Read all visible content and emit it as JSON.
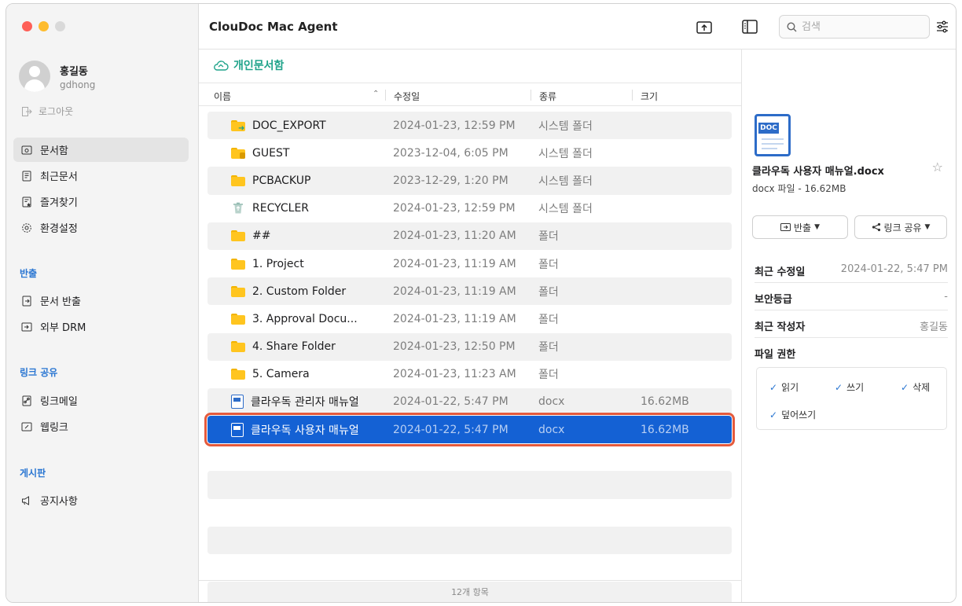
{
  "app": {
    "title": "ClouDoc Mac Agent"
  },
  "search": {
    "placeholder": "검색"
  },
  "user": {
    "name": "홍길동",
    "id": "gdhong",
    "logout_label": "로그아웃"
  },
  "sidebar": {
    "main_items": [
      {
        "label": "문서함",
        "icon": "inbox-icon",
        "active": true
      },
      {
        "label": "최근문서",
        "icon": "recent-doc-icon"
      },
      {
        "label": "즐겨찾기",
        "icon": "favorite-doc-icon"
      },
      {
        "label": "환경설정",
        "icon": "gear-icon"
      }
    ],
    "export_section": {
      "title": "반출",
      "items": [
        {
          "label": "문서 반출",
          "icon": "doc-export-icon"
        },
        {
          "label": "외부 DRM",
          "icon": "external-drm-icon"
        }
      ]
    },
    "link_section": {
      "title": "링크 공유",
      "items": [
        {
          "label": "링크메일",
          "icon": "link-mail-icon"
        },
        {
          "label": "웹링크",
          "icon": "web-link-icon"
        }
      ]
    },
    "board_section": {
      "title": "게시판",
      "items": [
        {
          "label": "공지사항",
          "icon": "megaphone-icon"
        }
      ]
    }
  },
  "location": {
    "label": "개인문서함",
    "icon": "cloud-icon"
  },
  "columns": {
    "name": "이름",
    "date": "수정일",
    "type": "종류",
    "size": "크기"
  },
  "files": [
    {
      "name": "DOC_EXPORT",
      "date": "2024-01-23, 12:59 PM",
      "type": "시스템 폴더",
      "size": "",
      "icon": "folder-export-icon"
    },
    {
      "name": "GUEST",
      "date": "2023-12-04, 6:05 PM",
      "type": "시스템 폴더",
      "size": "",
      "icon": "folder-guest-icon"
    },
    {
      "name": "PCBACKUP",
      "date": "2023-12-29, 1:20 PM",
      "type": "시스템 폴더",
      "size": "",
      "icon": "folder-icon"
    },
    {
      "name": "RECYCLER",
      "date": "2024-01-23, 12:59 PM",
      "type": "시스템 폴더",
      "size": "",
      "icon": "recycle-bin-icon"
    },
    {
      "name": "##",
      "date": "2024-01-23, 11:20 AM",
      "type": "폴더",
      "size": "",
      "icon": "folder-icon"
    },
    {
      "name": "1. Project",
      "date": "2024-01-23, 11:19 AM",
      "type": "폴더",
      "size": "",
      "icon": "folder-icon"
    },
    {
      "name": "2. Custom Folder",
      "date": "2024-01-23, 11:19 AM",
      "type": "폴더",
      "size": "",
      "icon": "folder-icon"
    },
    {
      "name": "3. Approval Docu...",
      "date": "2024-01-23, 11:19 AM",
      "type": "폴더",
      "size": "",
      "icon": "folder-icon"
    },
    {
      "name": "4. Share Folder",
      "date": "2024-01-23, 12:50 PM",
      "type": "폴더",
      "size": "",
      "icon": "folder-icon"
    },
    {
      "name": "5. Camera",
      "date": "2024-01-23, 11:23 AM",
      "type": "폴더",
      "size": "",
      "icon": "folder-icon"
    },
    {
      "name": "클라우독 관리자 매뉴얼",
      "date": "2024-01-22, 5:47 PM",
      "type": "docx",
      "size": "16.62MB",
      "icon": "docx-icon"
    },
    {
      "name": "클라우독 사용자 매뉴얼",
      "date": "2024-01-22, 5:47 PM",
      "type": "docx",
      "size": "16.62MB",
      "icon": "docx-icon",
      "selected": true
    }
  ],
  "footer": {
    "count_label": "12개 항목"
  },
  "detail": {
    "icon_label": "DOC",
    "file_name": "클라우독 사용자 매뉴얼.docx",
    "file_sub": "docx 파일 - 16.62MB",
    "export_button": "반출",
    "share_button": "링크 공유",
    "fields": [
      {
        "key": "최근 수정일",
        "value": "2024-01-22, 5:47 PM"
      },
      {
        "key": "보안등급",
        "value": "-"
      },
      {
        "key": "최근 작성자",
        "value": "홍길동"
      }
    ],
    "permissions_title": "파일 권한",
    "permissions": [
      "읽기",
      "쓰기",
      "삭제",
      "덮어쓰기"
    ]
  },
  "colors": {
    "accent": "#2a76d2",
    "selection": "#1461d4",
    "highlight_outline": "#e55a3c",
    "location": "#1fa38a"
  }
}
